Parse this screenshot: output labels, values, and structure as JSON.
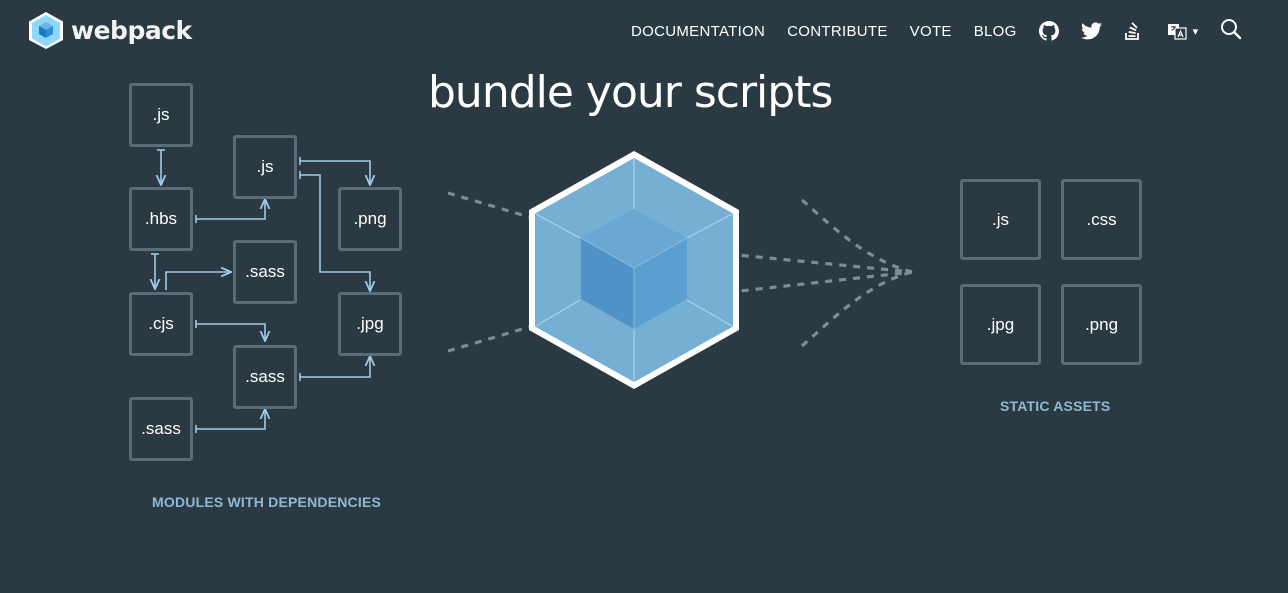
{
  "header": {
    "logo_text": "webpack",
    "nav": [
      {
        "label": "DOCUMENTATION"
      },
      {
        "label": "CONTRIBUTE"
      },
      {
        "label": "VOTE"
      },
      {
        "label": "BLOG"
      }
    ],
    "icons": [
      "github-icon",
      "twitter-icon",
      "stack-overflow-icon",
      "language-icon",
      "search-icon"
    ],
    "lang_caret": "▾"
  },
  "hero": {
    "headline": "bundle your scripts",
    "modules": [
      ".js",
      ".js",
      ".hbs",
      ".png",
      ".sass",
      ".cjs",
      ".jpg",
      ".sass",
      ".sass"
    ],
    "modules_caption": "MODULES WITH DEPENDENCIES",
    "assets": [
      ".js",
      ".css",
      ".jpg",
      ".png"
    ],
    "assets_caption": "STATIC ASSETS"
  },
  "colors": {
    "background": "#2b3a42",
    "box_border": "#5a6c78",
    "arrow": "#9fcbe8",
    "caption": "#8eb8d6",
    "cube_outer": "#8ed6fb",
    "cube_inner": "#1c78c0"
  }
}
